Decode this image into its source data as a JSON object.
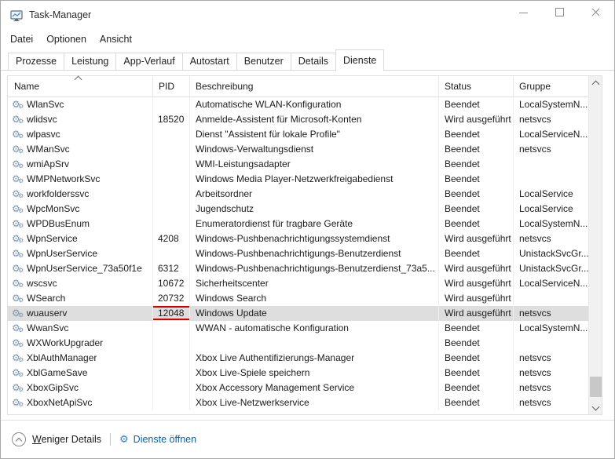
{
  "window": {
    "title": "Task-Manager"
  },
  "menu": {
    "items": [
      "Datei",
      "Optionen",
      "Ansicht"
    ]
  },
  "tabs": [
    {
      "label": "Prozesse",
      "active": false
    },
    {
      "label": "Leistung",
      "active": false
    },
    {
      "label": "App-Verlauf",
      "active": false
    },
    {
      "label": "Autostart",
      "active": false
    },
    {
      "label": "Benutzer",
      "active": false
    },
    {
      "label": "Details",
      "active": false
    },
    {
      "label": "Dienste",
      "active": true
    }
  ],
  "table": {
    "columns": [
      "Name",
      "PID",
      "Beschreibung",
      "Status",
      "Gruppe"
    ],
    "sort": {
      "column": "Name",
      "direction": "ascending"
    },
    "rows": [
      {
        "name": "WlanSvc",
        "pid": "",
        "description": "Automatische WLAN-Konfiguration",
        "status": "Beendet",
        "group": "LocalSystemN...",
        "highlighted": false,
        "pid_boxed": false
      },
      {
        "name": "wlidsvc",
        "pid": "18520",
        "description": "Anmelde-Assistent für Microsoft-Konten",
        "status": "Wird ausgeführt",
        "group": "netsvcs",
        "highlighted": false,
        "pid_boxed": false
      },
      {
        "name": "wlpasvc",
        "pid": "",
        "description": "Dienst \"Assistent für lokale Profile\"",
        "status": "Beendet",
        "group": "LocalServiceN...",
        "highlighted": false,
        "pid_boxed": false
      },
      {
        "name": "WManSvc",
        "pid": "",
        "description": "Windows-Verwaltungsdienst",
        "status": "Beendet",
        "group": "netsvcs",
        "highlighted": false,
        "pid_boxed": false
      },
      {
        "name": "wmiApSrv",
        "pid": "",
        "description": "WMI-Leistungsadapter",
        "status": "Beendet",
        "group": "",
        "highlighted": false,
        "pid_boxed": false
      },
      {
        "name": "WMPNetworkSvc",
        "pid": "",
        "description": "Windows Media Player-Netzwerkfreigabedienst",
        "status": "Beendet",
        "group": "",
        "highlighted": false,
        "pid_boxed": false
      },
      {
        "name": "workfolderssvc",
        "pid": "",
        "description": "Arbeitsordner",
        "status": "Beendet",
        "group": "LocalService",
        "highlighted": false,
        "pid_boxed": false
      },
      {
        "name": "WpcMonSvc",
        "pid": "",
        "description": "Jugendschutz",
        "status": "Beendet",
        "group": "LocalService",
        "highlighted": false,
        "pid_boxed": false
      },
      {
        "name": "WPDBusEnum",
        "pid": "",
        "description": "Enumeratordienst für tragbare Geräte",
        "status": "Beendet",
        "group": "LocalSystemN...",
        "highlighted": false,
        "pid_boxed": false
      },
      {
        "name": "WpnService",
        "pid": "4208",
        "description": "Windows-Pushbenachrichtigungssystemdienst",
        "status": "Wird ausgeführt",
        "group": "netsvcs",
        "highlighted": false,
        "pid_boxed": false
      },
      {
        "name": "WpnUserService",
        "pid": "",
        "description": "Windows-Pushbenachrichtigungs-Benutzerdienst",
        "status": "Beendet",
        "group": "UnistackSvcGr...",
        "highlighted": false,
        "pid_boxed": false
      },
      {
        "name": "WpnUserService_73a50f1e",
        "pid": "6312",
        "description": "Windows-Pushbenachrichtigungs-Benutzerdienst_73a5...",
        "status": "Wird ausgeführt",
        "group": "UnistackSvcGr...",
        "highlighted": false,
        "pid_boxed": false
      },
      {
        "name": "wscsvc",
        "pid": "10672",
        "description": "Sicherheitscenter",
        "status": "Wird ausgeführt",
        "group": "LocalServiceN...",
        "highlighted": false,
        "pid_boxed": false
      },
      {
        "name": "WSearch",
        "pid": "20732",
        "description": "Windows Search",
        "status": "Wird ausgeführt",
        "group": "",
        "highlighted": false,
        "pid_boxed": false
      },
      {
        "name": "wuauserv",
        "pid": "12048",
        "description": "Windows Update",
        "status": "Wird ausgeführt",
        "group": "netsvcs",
        "highlighted": true,
        "pid_boxed": true
      },
      {
        "name": "WwanSvc",
        "pid": "",
        "description": "WWAN - automatische Konfiguration",
        "status": "Beendet",
        "group": "LocalSystemN...",
        "highlighted": false,
        "pid_boxed": false
      },
      {
        "name": "WXWorkUpgrader",
        "pid": "",
        "description": "",
        "status": "Beendet",
        "group": "",
        "highlighted": false,
        "pid_boxed": false
      },
      {
        "name": "XblAuthManager",
        "pid": "",
        "description": "Xbox Live Authentifizierungs-Manager",
        "status": "Beendet",
        "group": "netsvcs",
        "highlighted": false,
        "pid_boxed": false
      },
      {
        "name": "XblGameSave",
        "pid": "",
        "description": "Xbox Live-Spiele speichern",
        "status": "Beendet",
        "group": "netsvcs",
        "highlighted": false,
        "pid_boxed": false
      },
      {
        "name": "XboxGipSvc",
        "pid": "",
        "description": "Xbox Accessory Management Service",
        "status": "Beendet",
        "group": "netsvcs",
        "highlighted": false,
        "pid_boxed": false
      },
      {
        "name": "XboxNetApiSvc",
        "pid": "",
        "description": "Xbox Live-Netzwerkservice",
        "status": "Beendet",
        "group": "netsvcs",
        "highlighted": false,
        "pid_boxed": false
      }
    ]
  },
  "footer": {
    "details_underline": "W",
    "details_rest": "eniger Details",
    "open_services": "Dienste öffnen"
  },
  "icons": {
    "service_gear": "⚙",
    "footer_gear": "⚙"
  },
  "colors": {
    "highlight_row": "#dedede",
    "annotation_red": "#d40000",
    "link_blue": "#0063b1",
    "service_gear": "#7e95aa"
  }
}
